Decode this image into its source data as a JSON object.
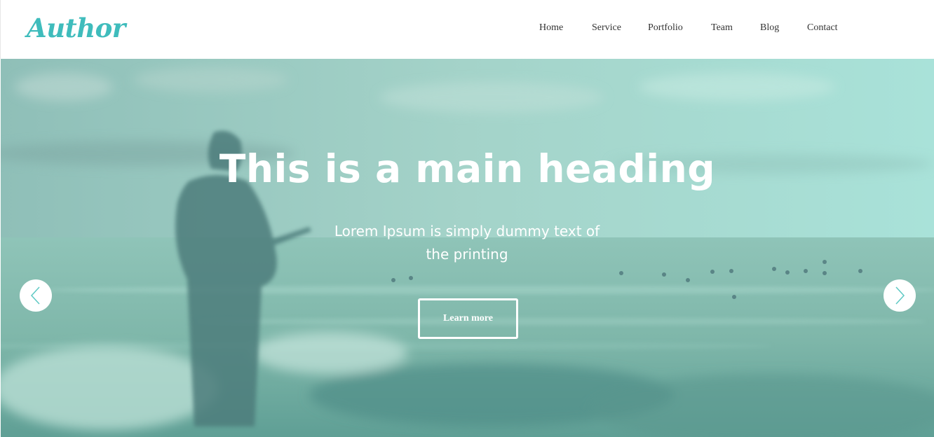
{
  "brand": {
    "logo_text": "Author",
    "accent_color": "#3fbcbc"
  },
  "nav": {
    "items": [
      {
        "label": "Home"
      },
      {
        "label": "Service"
      },
      {
        "label": "Portfolio"
      },
      {
        "label": "Team"
      },
      {
        "label": "Blog"
      },
      {
        "label": "Contact"
      }
    ]
  },
  "hero": {
    "heading": "This is a main heading",
    "subheading": "Lorem Ipsum is simply dummy text of the printing",
    "button_label": "Learn more",
    "overlay_color": "#6fc9bd",
    "prev_icon": "chevron-left-icon",
    "next_icon": "chevron-right-icon"
  }
}
